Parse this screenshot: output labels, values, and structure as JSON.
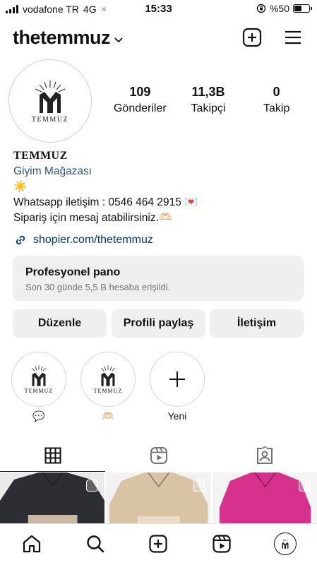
{
  "status_bar": {
    "carrier": "vodafone TR",
    "network": "4G",
    "time": "15:33",
    "battery_text": "%50",
    "battery_level": 0.5
  },
  "header": {
    "username": "thetemmuz",
    "icons": [
      "chevron-down-icon",
      "new-post-icon",
      "menu-icon"
    ]
  },
  "profile": {
    "logo_text": "TEMMUZ",
    "stats": [
      {
        "value": "109",
        "label": "Gönderiler"
      },
      {
        "value": "11,3B",
        "label": "Takipçi"
      },
      {
        "value": "0",
        "label": "Takip"
      }
    ]
  },
  "bio": {
    "name": "TEMMUZ",
    "category": "Giyim Mağazası",
    "line_emoji": "☀️",
    "line_whatsapp": "Whatsapp iletişim : 0546 464 2915 💌",
    "line_order": "Sipariş için mesaj atabilirsiniz.🫶🏻",
    "link": "shopier.com/thetemmuz"
  },
  "dashboard": {
    "title": "Profesyonel pano",
    "subtitle": "Son 30 günde 5,5 B hesaba erişildi."
  },
  "buttons": {
    "edit": "Düzenle",
    "share": "Profili paylaş",
    "contact": "İletişim"
  },
  "highlights": [
    {
      "label": "💬",
      "logo_text": "TEMMUZ"
    },
    {
      "label": "🫶🏻",
      "logo_text": "TEMMUZ"
    },
    {
      "label": "Yeni"
    }
  ],
  "tabs": [
    "grid-icon",
    "reels-icon",
    "tagged-icon"
  ],
  "bottom_nav": [
    "home-icon",
    "search-icon",
    "create-icon",
    "reels-icon",
    "profile-avatar"
  ],
  "colors": {
    "link": "#00376b",
    "category": "#385185",
    "button_bg": "#efefef",
    "post_colors": [
      "#2c2e33",
      "#d9c3a5",
      "#d6328c"
    ]
  }
}
